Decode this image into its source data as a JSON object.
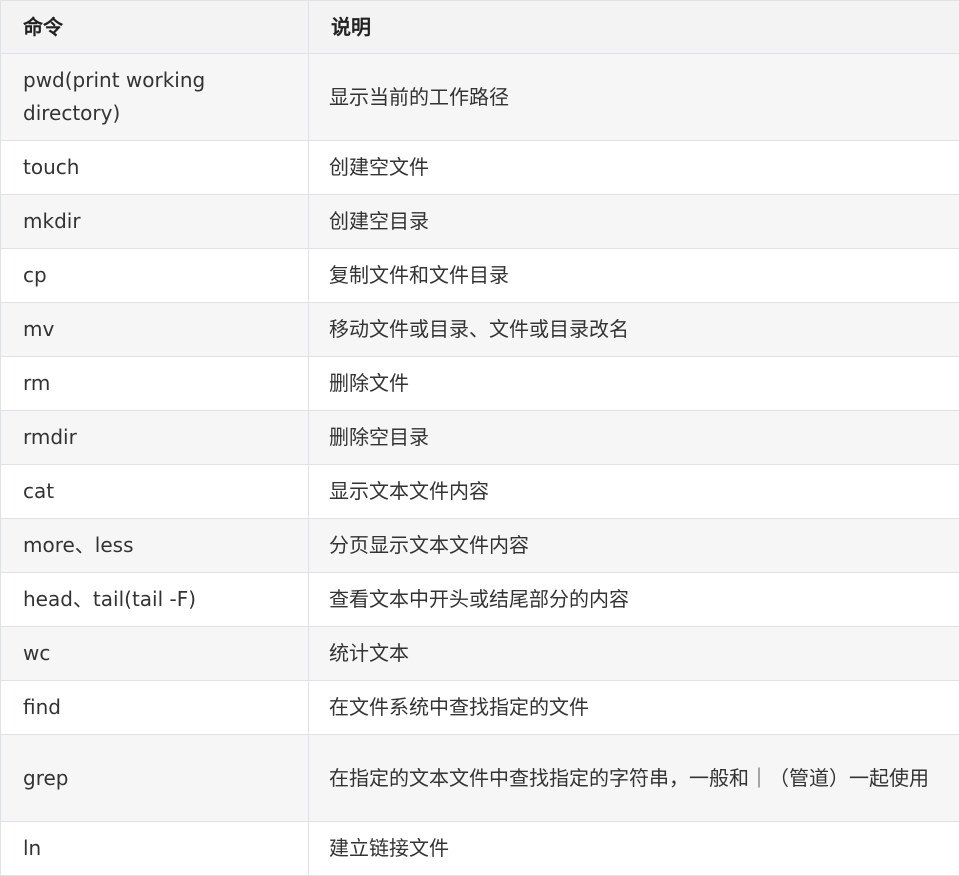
{
  "table": {
    "headers": [
      "命令",
      "说明"
    ],
    "rows": [
      {
        "command": "pwd(print working directory)",
        "description": "显示当前的工作路径"
      },
      {
        "command": "touch",
        "description": "创建空文件"
      },
      {
        "command": "mkdir",
        "description": "创建空目录"
      },
      {
        "command": "cp",
        "description": "复制文件和文件目录"
      },
      {
        "command": "mv",
        "description": "移动文件或目录、文件或目录改名"
      },
      {
        "command": "rm",
        "description": "删除文件"
      },
      {
        "command": "rmdir",
        "description": "删除空目录"
      },
      {
        "command": "cat",
        "description": "显示文本文件内容"
      },
      {
        "command": "more、less",
        "description": "分页显示文本文件内容"
      },
      {
        "command": "head、tail(tail -F)",
        "description": "查看文本中开头或结尾部分的内容"
      },
      {
        "command": "wc",
        "description": "统计文本"
      },
      {
        "command": "find",
        "description": "在文件系统中查找指定的文件"
      },
      {
        "command": "grep",
        "description": "在指定的文本文件中查找指定的字符串，一般和｜（管道）一起使用"
      },
      {
        "command": "ln",
        "description": "建立链接文件"
      }
    ]
  }
}
